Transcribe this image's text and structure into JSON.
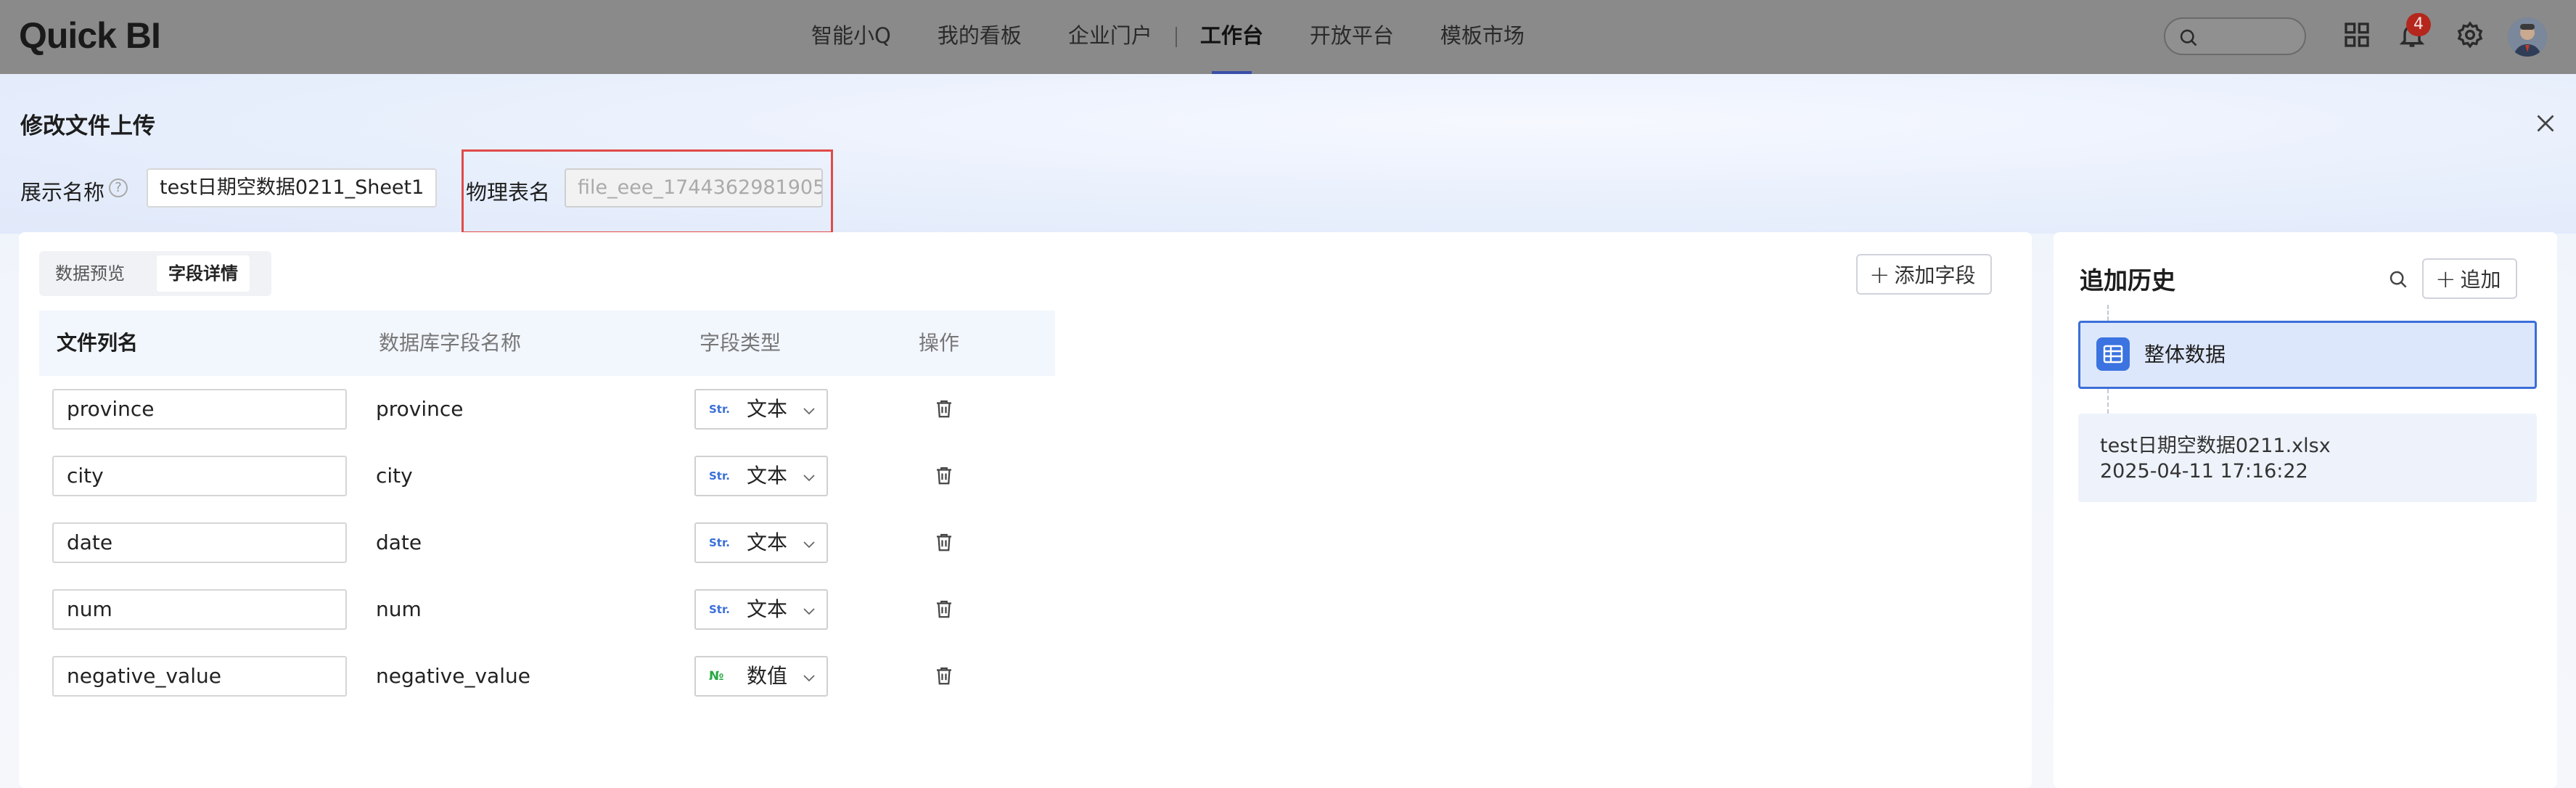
{
  "app": {
    "logo": "Quick BI",
    "nav": [
      {
        "label": "智能小Q"
      },
      {
        "label": "我的看板"
      },
      {
        "label": "企业门户"
      },
      {
        "label": "工作台"
      },
      {
        "label": "开放平台"
      },
      {
        "label": "模板市场"
      }
    ],
    "active_nav": "工作台",
    "notification_count": "4"
  },
  "dialog": {
    "title": "修改文件上传",
    "display_name_label": "展示名称",
    "display_name_value": "test日期空数据0211_Sheet1",
    "physical_name_label": "物理表名",
    "physical_name_value": "file_eee_1744362981905"
  },
  "tabs": [
    {
      "label": "数据预览"
    },
    {
      "label": "字段详情"
    }
  ],
  "active_tab": "字段详情",
  "add_field_label": "添加字段",
  "table": {
    "headers": [
      "文件列名",
      "数据库字段名称",
      "字段类型",
      "操作"
    ],
    "rows": [
      {
        "file_col": "province",
        "db_col": "province",
        "type_tag": "Str.",
        "type": "文本"
      },
      {
        "file_col": "city",
        "db_col": "city",
        "type_tag": "Str.",
        "type": "文本"
      },
      {
        "file_col": "date",
        "db_col": "date",
        "type_tag": "Str.",
        "type": "文本"
      },
      {
        "file_col": "num",
        "db_col": "num",
        "type_tag": "Str.",
        "type": "文本"
      },
      {
        "file_col": "negative_value",
        "db_col": "negative_value",
        "type_tag": "№",
        "type": "数值"
      }
    ]
  },
  "history": {
    "title": "追加历史",
    "add_label": "追加",
    "all_label": "整体数据",
    "items": [
      {
        "name": "test日期空数据0211.xlsx",
        "time": "2025-04-11 17:16:22"
      }
    ]
  },
  "colors": {
    "accent": "#3b6fd8",
    "highlight": "#e04a4a",
    "badge": "#b5271c",
    "num_tag": "#28a745"
  }
}
